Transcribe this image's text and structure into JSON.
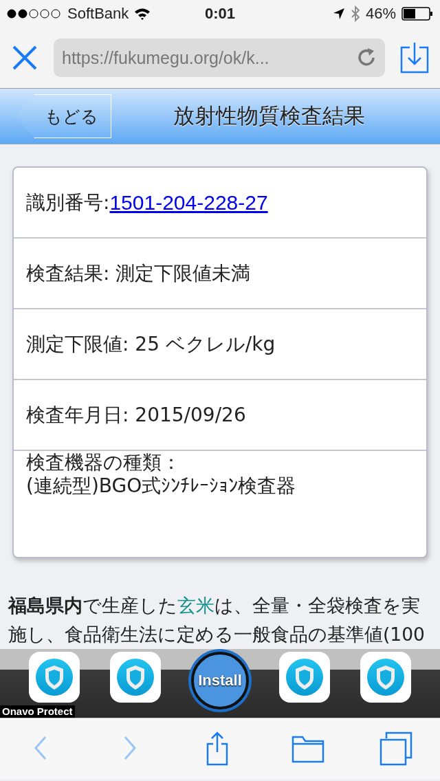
{
  "status_bar": {
    "carrier": "SoftBank",
    "time": "0:01",
    "battery": "46%"
  },
  "browser_bar": {
    "url": "https://fukumegu.org/ok/k..."
  },
  "header": {
    "back": "もどる",
    "title": "放射性物質検査結果"
  },
  "details": [
    {
      "kind": "link",
      "label": "識別番号:",
      "value": "1501-204-228-27"
    },
    {
      "kind": "inline",
      "label": "検査結果: ",
      "value": "測定下限値未満"
    },
    {
      "kind": "inline",
      "label": "測定下限値: ",
      "value": "25 ベクレル/kg"
    },
    {
      "kind": "inline",
      "label": "検査年月日: ",
      "value": "2015/09/26"
    },
    {
      "kind": "block",
      "label": "検査機器の種類：",
      "value": "(連続型)BGO式ｼﾝﾁﾚｰｼｮﾝ検査器"
    }
  ],
  "paragraph_lines": [
    [
      {
        "kind": "bold",
        "text": "福島県内"
      },
      {
        "kind": "plain",
        "text": "で生産した"
      },
      {
        "kind": "link",
        "text": "玄米"
      },
      {
        "kind": "plain",
        "text": "は、全量・全袋検査を実"
      }
    ],
    [
      {
        "kind": "plain",
        "text": "施し、食品衛生法に定める一般食品の基準値(100"
      }
    ]
  ],
  "ad_banner": {
    "app_name": "Onavo Protect",
    "button": "Install"
  },
  "toolbar": [
    {
      "kind": "back",
      "disabled": true
    },
    {
      "kind": "forward",
      "disabled": true
    },
    {
      "kind": "share",
      "disabled": false
    },
    {
      "kind": "bookmarks",
      "disabled": false
    },
    {
      "kind": "tabs",
      "disabled": false
    }
  ]
}
